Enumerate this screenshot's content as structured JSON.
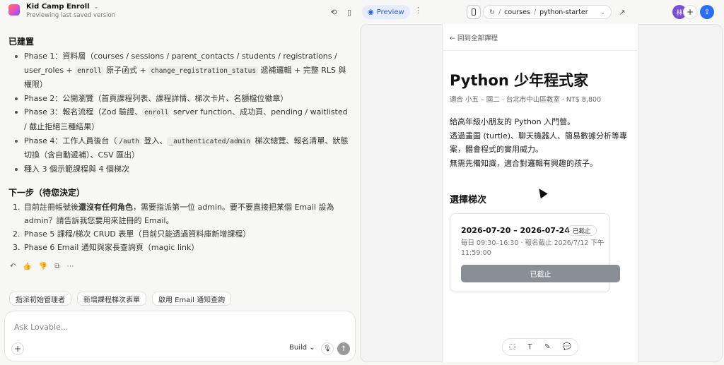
{
  "app": {
    "project_name": "Kid Camp Enroll",
    "project_sub": "Previewing last saved version",
    "preview_label": "Preview",
    "url_segments": [
      "/",
      "courses",
      "/",
      "python-starter"
    ],
    "avatar_initial": "林"
  },
  "icons": {
    "history": "history-icon",
    "layout": "sidebar-toggle-icon",
    "eye": "eye-icon",
    "device": "mobile-device-icon",
    "refresh": "refresh-icon",
    "external": "external-link-icon",
    "share": "share-icon",
    "undo": "undo-icon",
    "thumbs_up": "thumbs-up-icon",
    "thumbs_down": "thumbs-down-icon",
    "copy": "copy-icon",
    "more": "more-icon"
  },
  "chat": {
    "built_heading": "已建置",
    "built_items": [
      {
        "pre": "Phase 1：資料層（courses / sessions / parent_contacts / students / registrations / user_roles + ",
        "c1": "enroll",
        "mid": " 原子函式 + ",
        "c2": "change_registration_status",
        "post": " 遞補邏輯 + 完整 RLS 與權限）"
      },
      {
        "pre": "Phase 2：公開瀏覽（首頁課程列表、課程詳情、梯次卡片、名額檔位徽章）"
      },
      {
        "pre": "Phase 3：報名流程（Zod 驗證、",
        "c1": "enroll",
        "mid": " server function、成功頁、pending / waitlisted / 截止拒絕三種結果）"
      },
      {
        "pre": "Phase 4：工作人員後台（",
        "c1": "/auth",
        "mid": " 登入、",
        "c2": "_authenticated/admin",
        "post": " 梯次總覽、報名清單、狀態切換（含自動遞補）、CSV 匯出）"
      },
      {
        "pre": "種入 3 個示範課程與 4 個梯次"
      }
    ],
    "next_heading": "下一步（待您決定）",
    "next_items": [
      {
        "num": "1.",
        "pre": "目前註冊帳號後",
        "bold": "還沒有任何角色",
        "post": "，需要指派第一位 admin。要不要直接把某個 Email 設為 admin？請告訴我您要用來註冊的 Email。"
      },
      {
        "num": "2.",
        "pre": "Phase 5 課程/梯次 CRUD 表單（目前只能透過資料庫新增課程）"
      },
      {
        "num": "3.",
        "pre": "Phase 6 Email 通知與家長查詢頁（magic link）"
      }
    ],
    "chips": [
      "指派初始管理者",
      "新增課程梯次表單",
      "啟用 Email 通知查詢"
    ],
    "composer_placeholder": "Ask Lovable...",
    "mode_label": "Build"
  },
  "preview": {
    "back_link": "← 回到全部課程",
    "course_title": "Python 少年程式家",
    "course_meta": "適合 小五 – 國二 · 台北市中山區教室 · NT$ 8,800",
    "description": [
      "給高年級小朋友的 Python 入門營。",
      "透過畫圖 (turtle)、聊天機器人、簡易數據分析等專案，體會程式的實用威力。",
      "無需先備知識，適合對邏輯有興趣的孩子。"
    ],
    "sessions_heading": "選擇梯次",
    "session": {
      "dates": "2026-07-20 – 2026-07-24",
      "badge": "已截止",
      "schedule": "每日 09:30–16:30 · 報名截止 2026/7/12 下午11:59:00",
      "button": "已截止"
    }
  }
}
